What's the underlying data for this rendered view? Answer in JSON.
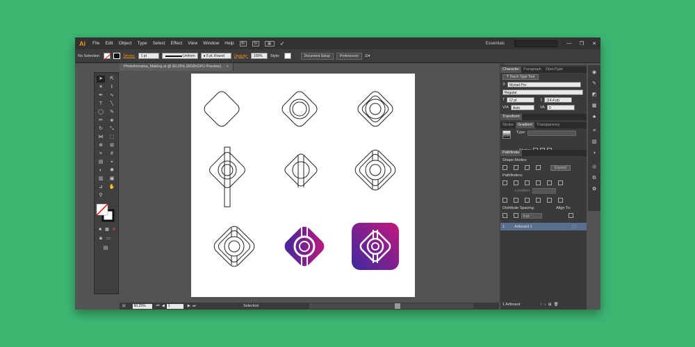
{
  "app": {
    "logo": "Ai"
  },
  "menu": [
    "File",
    "Edit",
    "Object",
    "Type",
    "Select",
    "Effect",
    "View",
    "Window",
    "Help"
  ],
  "menubar_right": {
    "workspace": "Essentials",
    "minimize": "—",
    "restore": "❐",
    "close": "✕"
  },
  "control_bar": {
    "selection": "No Selection",
    "stroke_label": "Stroke:",
    "stroke_weight": "1 pt",
    "profile": "Uniform",
    "brush": "5 pt. Round",
    "opacity_label": "Opacity:",
    "opacity_value": "100%",
    "style_label": "Style:",
    "document_setup": "Document Setup",
    "preferences": "Preferences"
  },
  "document": {
    "tab_title": "Photofonrama_Making.ai @ 60.25% (RGB/GPU Preview)",
    "tab_close": "×"
  },
  "status_bar": {
    "zoom": "60.25%",
    "page": "1",
    "tool": "Selection"
  },
  "character_panel": {
    "tabs": [
      "Character",
      "Paragraph",
      "OpenType"
    ],
    "touch_type": "Touch Type Tool",
    "font": "Myriad Pro",
    "style": "Regular",
    "size": "12 pt",
    "leading": "(14,4 pt)",
    "kerning": "Auto",
    "tracking": "0"
  },
  "transform_panel": {
    "title": "Transform"
  },
  "gradient_panel": {
    "tabs": [
      "Stroke",
      "Gradient",
      "Transparency"
    ],
    "type_label": "Type:",
    "stroke_label": "Stroke:"
  },
  "pathfinder_panel": {
    "title": "Pathfinder",
    "shape_modes": "Shape Modes:",
    "expand": "Expand",
    "pathfinders": "Pathfinders:",
    "location": "Location:"
  },
  "align_panel": {
    "distribute_spacing": "Distribute Spacing:",
    "align_to": "Align To:",
    "spacing": "0 pt"
  },
  "artboards_panel": {
    "rows": [
      {
        "num": "1",
        "name": "Artboard 1"
      }
    ],
    "footer": "1 Artboard"
  },
  "colors": {
    "background": "#3db672",
    "brand_orange": "#f7941d",
    "gradient_start": "#5a2d9c",
    "gradient_end": "#c2187c"
  }
}
